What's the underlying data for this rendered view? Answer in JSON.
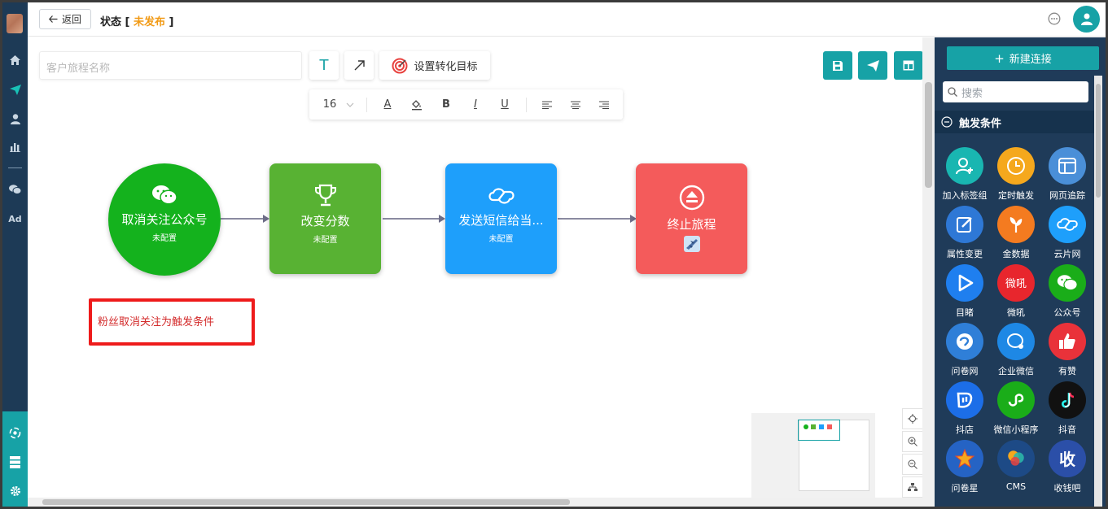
{
  "header": {
    "back_label": "返回",
    "status_prefix": "状态 [ ",
    "status_value": "未发布",
    "status_suffix": " ]"
  },
  "toolbar": {
    "name_placeholder": "客户旅程名称",
    "set_goal_label": "设置转化目标",
    "font_size": "16",
    "font_color_label": "A",
    "bold_label": "B",
    "italic_label": "I",
    "underline_label": "U"
  },
  "flow": {
    "nodes": [
      {
        "title": "取消关注公众号",
        "subtitle": "未配置",
        "color": "#14b21d",
        "icon": "wechat-icon"
      },
      {
        "title": "改变分数",
        "subtitle": "未配置",
        "color": "#58b233",
        "icon": "trophy-icon"
      },
      {
        "title": "发送短信给当...",
        "subtitle": "未配置",
        "color": "#1e9ffb",
        "icon": "cloud-link-icon"
      },
      {
        "title": "终止旅程",
        "subtitle": "",
        "color": "#f45b5b",
        "icon": "eject-icon"
      }
    ],
    "note": "粉丝取消关注为触发条件"
  },
  "panel": {
    "new_connection_label": "新建连接",
    "search_placeholder": "搜索",
    "section_title": "触发条件",
    "items": [
      {
        "label": "加入标签组",
        "color": "#19b6b1",
        "icon": "add-user-icon"
      },
      {
        "label": "定时触发",
        "color": "#f5a81d",
        "icon": "clock-icon"
      },
      {
        "label": "网页追踪",
        "color": "#4a8fd8",
        "icon": "webpage-icon"
      },
      {
        "label": "属性变更",
        "color": "#2e78d6",
        "icon": "edit-icon"
      },
      {
        "label": "金数据",
        "color": "#f47b20",
        "icon": "sprout-icon"
      },
      {
        "label": "云片网",
        "color": "#1e9ffb",
        "icon": "cloud-link-icon"
      },
      {
        "label": "目睹",
        "color": "#1f7fef",
        "icon": "play-icon"
      },
      {
        "label": "微吼",
        "color": "#e8262d",
        "icon": "weihou-icon"
      },
      {
        "label": "公众号",
        "color": "#1aad19",
        "icon": "wechat-icon"
      },
      {
        "label": "问卷网",
        "color": "#2f7fd8",
        "icon": "wenjuan-icon"
      },
      {
        "label": "企业微信",
        "color": "#1e88e5",
        "icon": "work-wechat-icon"
      },
      {
        "label": "有赞",
        "color": "#e9323a",
        "icon": "thumbs-up-icon"
      },
      {
        "label": "抖店",
        "color": "#1c6ee8",
        "icon": "doudian-icon"
      },
      {
        "label": "微信小程序",
        "color": "#1aad19",
        "icon": "mini-program-icon"
      },
      {
        "label": "抖音",
        "color": "#111111",
        "icon": "tiktok-icon"
      },
      {
        "label": "问卷星",
        "color": "#2563c4",
        "icon": "star-icon"
      },
      {
        "label": "CMS",
        "color": "#1d4a86",
        "icon": "cms-icon"
      },
      {
        "label": "收钱吧",
        "color": "#2b4fa8",
        "icon": "shouqianba-icon"
      }
    ]
  }
}
